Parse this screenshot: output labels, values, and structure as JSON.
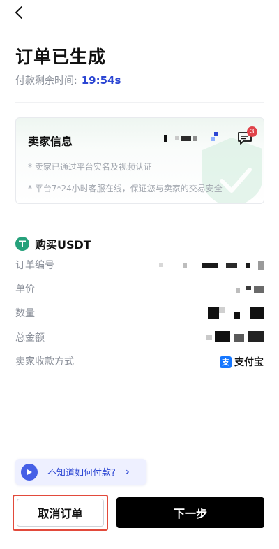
{
  "header": {
    "back_icon": "chevron-left-icon",
    "title": "订单已生成"
  },
  "timer": {
    "label": "付款剩余时间:",
    "value": "19:54s"
  },
  "seller": {
    "title": "卖家信息",
    "unread_count": "3",
    "notes": [
      "* 卖家已通过平台实名及视频认证",
      "* 平台7*24小时客服在线，保证您与卖家的交易安全"
    ]
  },
  "order": {
    "product": "购买USDT",
    "rows": [
      {
        "label": "订单编号"
      },
      {
        "label": "单价"
      },
      {
        "label": "数量"
      },
      {
        "label": "总金额"
      },
      {
        "label": "卖家收款方式",
        "value": "支付宝"
      }
    ]
  },
  "help": {
    "text": "不知道如何付款?",
    "chevron": "›"
  },
  "actions": {
    "cancel": "取消订单",
    "next": "下一步"
  },
  "colors": {
    "accent": "#2c46d3",
    "usdt_green": "#26a17b",
    "badge_red": "#e0434a",
    "highlight_red": "#e24a3b",
    "alipay_blue": "#1677ff"
  }
}
